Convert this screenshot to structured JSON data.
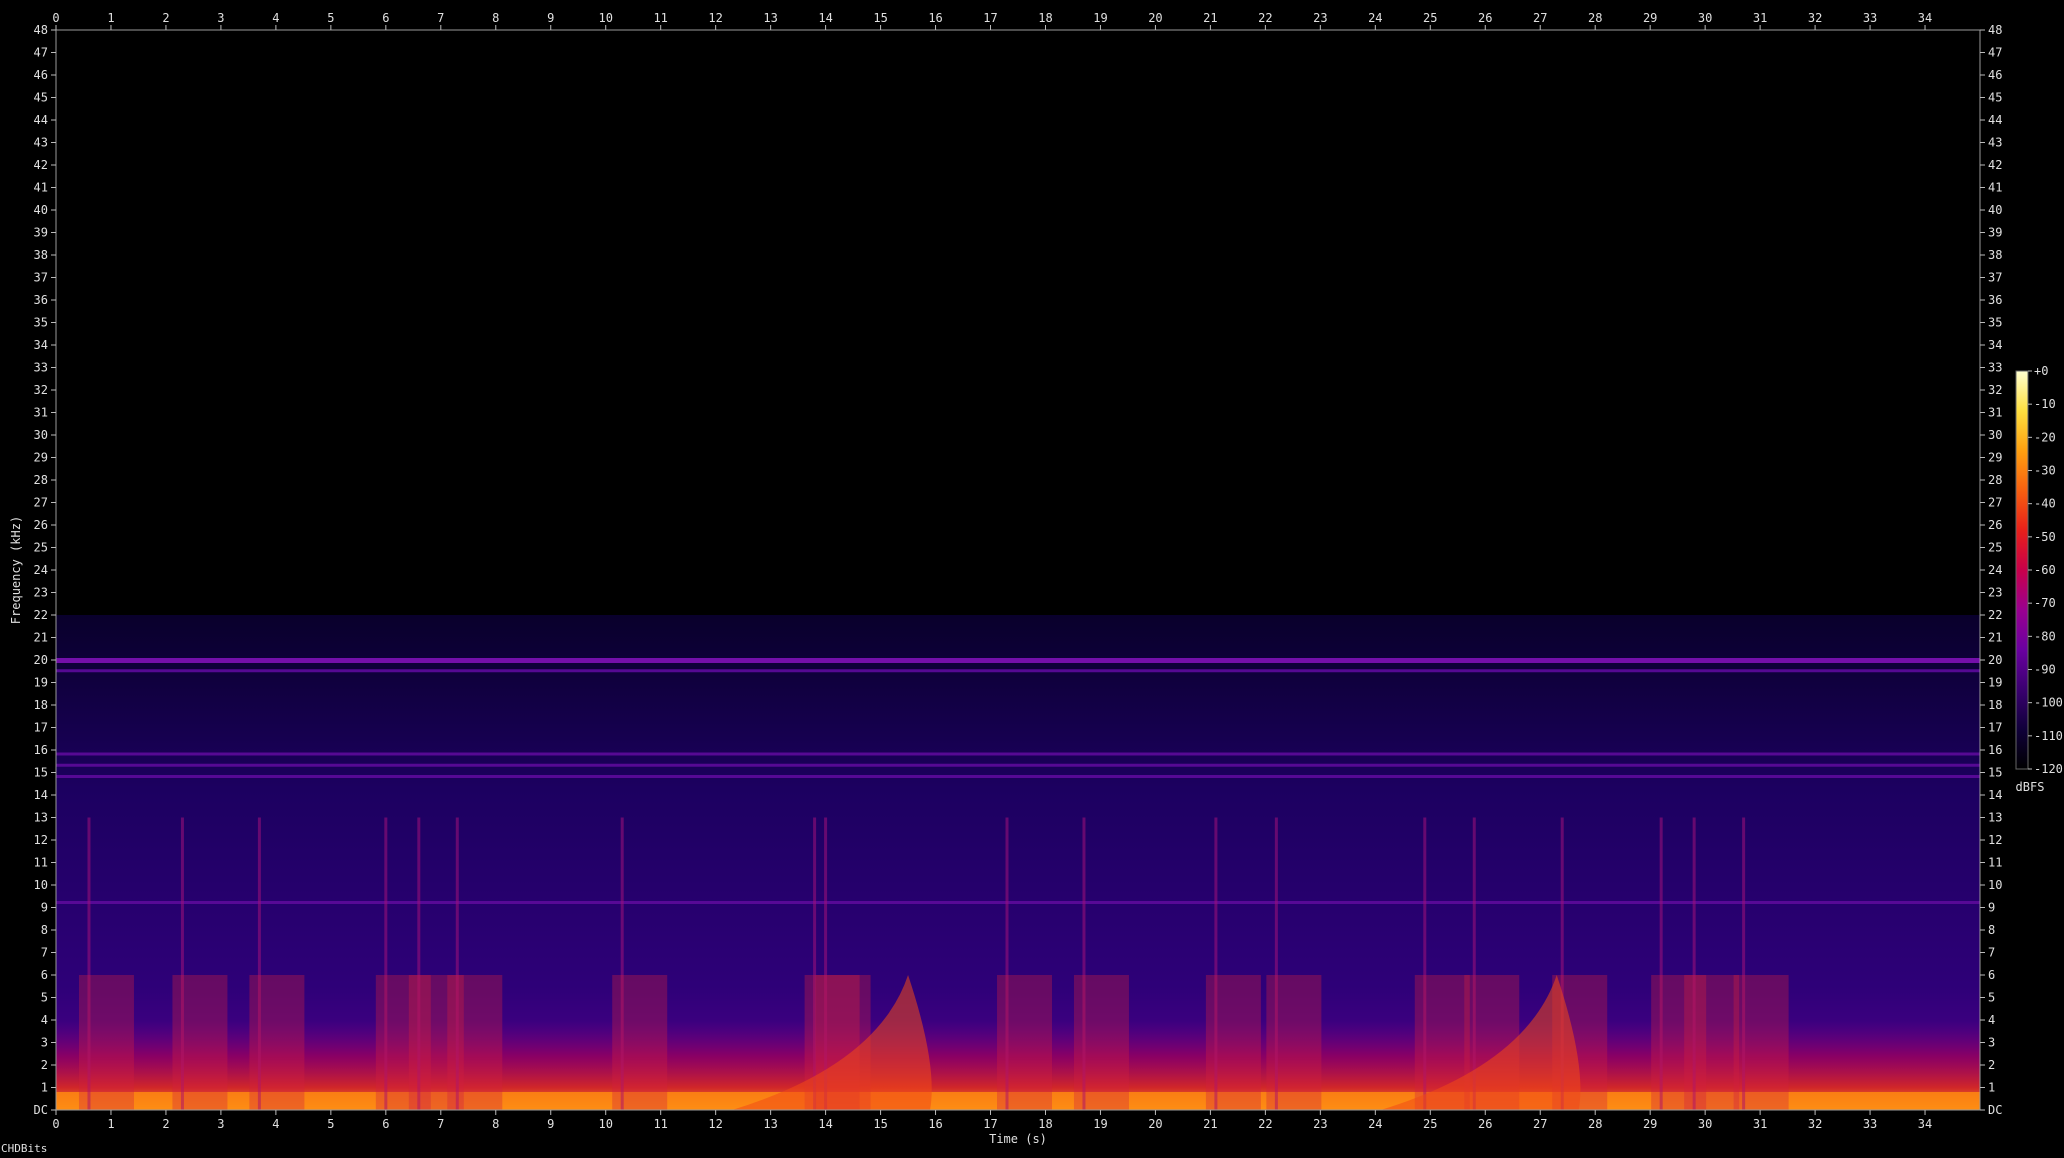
{
  "chart_data": {
    "type": "heatmap",
    "title": "",
    "xlabel": "Time (s)",
    "ylabel": "Frequency (kHz)",
    "xlim": [
      0,
      35
    ],
    "ylim": [
      0,
      48
    ],
    "x_ticks": [
      "0",
      "1",
      "2",
      "3",
      "4",
      "5",
      "6",
      "7",
      "8",
      "9",
      "10",
      "11",
      "12",
      "13",
      "14",
      "15",
      "16",
      "17",
      "18",
      "19",
      "20",
      "21",
      "22",
      "23",
      "24",
      "25",
      "26",
      "27",
      "28",
      "29",
      "30",
      "31",
      "32",
      "33",
      "34"
    ],
    "y_ticks": [
      "DC",
      "1",
      "2",
      "3",
      "4",
      "5",
      "6",
      "7",
      "8",
      "9",
      "10",
      "11",
      "12",
      "13",
      "14",
      "15",
      "16",
      "17",
      "18",
      "19",
      "20",
      "21",
      "22",
      "23",
      "24",
      "25",
      "26",
      "27",
      "28",
      "29",
      "30",
      "31",
      "32",
      "33",
      "34",
      "35",
      "36",
      "37",
      "38",
      "39",
      "40",
      "41",
      "42",
      "43",
      "44",
      "45",
      "46",
      "47",
      "48"
    ],
    "colorbar": {
      "label": "dBFS",
      "range": [
        -120,
        0
      ],
      "ticks": [
        "+0",
        "-10",
        "-20",
        "-30",
        "-40",
        "-50",
        "-60",
        "-70",
        "-80",
        "-90",
        "-100",
        "-110",
        "-120"
      ],
      "colors": [
        "#000000",
        "#10003a",
        "#3a0070",
        "#6a00a0",
        "#9a0090",
        "#c8004a",
        "#e8201a",
        "#f86010",
        "#ffa010",
        "#ffe040",
        "#ffffd0"
      ]
    },
    "content_cutoff_khz": 22,
    "tone_lines_khz": [
      20,
      19.5,
      15.8,
      15.3,
      14.8,
      9.2
    ],
    "onset_times_s": [
      0.6,
      2.3,
      3.7,
      6.0,
      6.6,
      7.3,
      10.3,
      13.8,
      14.0,
      17.3,
      18.7,
      21.1,
      22.2,
      24.9,
      25.8,
      27.4,
      29.2,
      29.8,
      30.7
    ],
    "swell_times_s": [
      15.5,
      27.3
    ]
  },
  "footer": {
    "credit": "CHDBits"
  }
}
